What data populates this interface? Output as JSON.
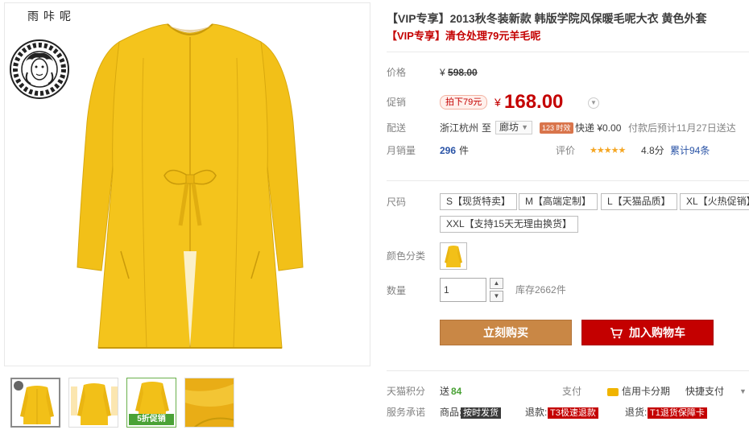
{
  "brand": {
    "text": "雨咔呢"
  },
  "product": {
    "title": "【VIP专享】2013秋冬装新款 韩版学院风保暖毛呢大衣 黄色外套",
    "subtitle": "【VIP专享】清仓处理79元羊毛呢"
  },
  "pricing": {
    "original_label": "价格",
    "original_currency": "¥",
    "original_price": "598.00",
    "promo_label": "促销",
    "promo_tag": "拍下79元",
    "promo_currency": "¥",
    "promo_price": "168.00"
  },
  "shipping": {
    "label": "配送",
    "from": "浙江杭州",
    "to_word": "至",
    "destination": "廊坊",
    "badge": "123 时效",
    "fee": "快递 ¥0.00",
    "eta": "付款后预计11月27日送达"
  },
  "sales": {
    "label": "月销量",
    "count": "296",
    "unit": "件",
    "rating_label": "评价",
    "stars": "★★★★★",
    "rating": "4.8分",
    "reviews": "累计94条"
  },
  "sizes": {
    "label": "尺码",
    "options": [
      "S【现货特卖】",
      "M【高端定制】",
      "L【天猫品质】",
      "XL【火热促销】",
      "XXL【支持15天无理由换货】"
    ]
  },
  "color": {
    "label": "颜色分类"
  },
  "quantity": {
    "label": "数量",
    "value": "1",
    "stock": "库存2662件"
  },
  "actions": {
    "buy_now": "立刻购买",
    "add_to_cart": "加入购物车"
  },
  "points": {
    "label": "天猫积分",
    "text": "送",
    "value": "84",
    "pay_label": "支付",
    "credit": "信用卡分期",
    "quick_pay": "快捷支付"
  },
  "service": {
    "label": "服务承诺",
    "goods_label": "商品:",
    "goods_tag": "按时发货",
    "refund_label": "退款:",
    "refund_tag": "T3极速退款",
    "return_label": "退货:",
    "return_tag": "T1退货保障卡"
  },
  "thumbnails": {
    "promo_text": "5折促销"
  },
  "colors": {
    "accent_red": "#c40000",
    "coat_yellow": "#f2c018",
    "buy_button": "#c98745"
  }
}
